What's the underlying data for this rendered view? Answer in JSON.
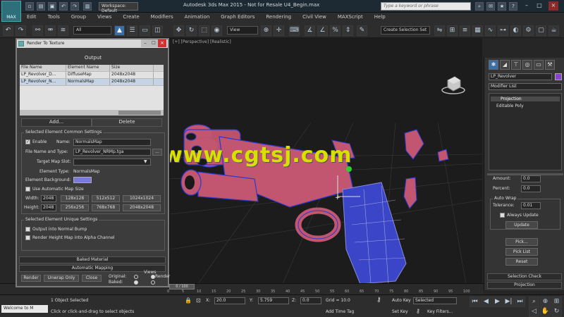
{
  "app": {
    "title": "Autodesk 3ds Max 2015 - Not for Resale  U4_Begin.max",
    "logo_text": "MAX",
    "workspace": "Workspace: Default",
    "search_placeholder": "Type a keyword or phrase"
  },
  "menu": [
    "Edit",
    "Tools",
    "Group",
    "Views",
    "Create",
    "Modifiers",
    "Animation",
    "Graph Editors",
    "Rendering",
    "Civil View",
    "MAXScript",
    "Help"
  ],
  "toolbar": {
    "selection_filter": "All",
    "reference_coord": "View",
    "named_selection": "Create Selection Set"
  },
  "viewport": {
    "label": "[+] [Perspective] [Realistic]",
    "watermark": "www.cgtsj.com"
  },
  "rtt": {
    "title": "Render To Texture",
    "output_header": "Output",
    "table_headers": [
      "File Name",
      "Element Name",
      "Size"
    ],
    "rows": [
      {
        "file": "LP_Revolver_D...",
        "element": "DiffuseMap",
        "size": "2048x2048"
      },
      {
        "file": "LP_Revolver_N...",
        "element": "NormalsMap",
        "size": "2048x2048"
      }
    ],
    "tab_auto": "Add...",
    "tab_delete": "Delete",
    "common_group": "Selected Element Common Settings",
    "enable_label": "Enable",
    "name_label": "Name:",
    "name_value": "NormalsMap",
    "file_name_type_label": "File Name and Type:",
    "file_name_value": "LP_Revolver_NRMp.tga",
    "target_map_slot_label": "Target Map Slot:",
    "element_type_label": "Element Type:",
    "element_type_value": "NormalsMap",
    "element_bg_label": "Element Background:",
    "auto_map_size_label": "Use Automatic Map Size",
    "width_label": "Width:",
    "width_value": "2048",
    "height_label": "Height:",
    "height_value": "2048",
    "size_buttons_row1": [
      "128x128",
      "512x512",
      "1024x1024"
    ],
    "size_buttons_row2": [
      "256x256",
      "768x768",
      "2048x2048"
    ],
    "unique_group": "Selected Element Unique Settings",
    "output_bump_label": "Output into Normal Bump",
    "render_height_label": "Render Height Map into Alpha Channel",
    "rollout_baked": "Baked Material",
    "rollout_automatic": "Automatic Mapping",
    "render_btn": "Render",
    "unwrap_btn": "Unwrap Only",
    "close_btn": "Close",
    "views_label": "Views",
    "render_label": "Render",
    "original_label": "Original:",
    "baked_label": "Baked:"
  },
  "cmdpanel": {
    "object_name": "LP_Revolver",
    "modifier_list": "Modifier List",
    "stack": [
      "Projection",
      "Editable Poly"
    ],
    "amount_label": "Amount:",
    "amount_value": "0.0",
    "percent_label": "Percent:",
    "percent_value": "0.0",
    "auto_wrap_label": "Auto Wrap",
    "tolerance_label": "Tolerance:",
    "tolerance_value": "0.01",
    "always_update_label": "Always Update",
    "update_btn": "Update",
    "pick_btn": "Pick...",
    "pick_list_btn": "Pick List",
    "reset_btn": "Reset",
    "rollout_selection": "Selection Check",
    "rollout_projection": "Projection"
  },
  "timeline": {
    "ticks": [
      "0",
      "5",
      "10",
      "15",
      "20",
      "25",
      "30",
      "35",
      "40",
      "45",
      "50",
      "55",
      "60",
      "65",
      "70",
      "75",
      "80",
      "85",
      "90",
      "95",
      "100"
    ],
    "frame_display": "0 / 100"
  },
  "status": {
    "welcome": "Welcome to M",
    "selected": "1 Object Selected",
    "prompt": "Click or click-and-drag to select objects",
    "x_label": "X:",
    "x_value": "20.0",
    "y_label": "Y:",
    "y_value": "5.759",
    "z_label": "Z:",
    "z_value": "0.0",
    "grid": "Grid = 10.0",
    "auto_key": "Auto Key",
    "set_key": "Set Key",
    "key_mode": "Selected",
    "key_filters": "Key Filters...",
    "add_time_tag": "Add Time Tag"
  },
  "colors": {
    "accent": "#3a6ea8",
    "watermark": "#d8e000",
    "gun_body": "#c25570",
    "gun_wire": "#2a3acc"
  }
}
